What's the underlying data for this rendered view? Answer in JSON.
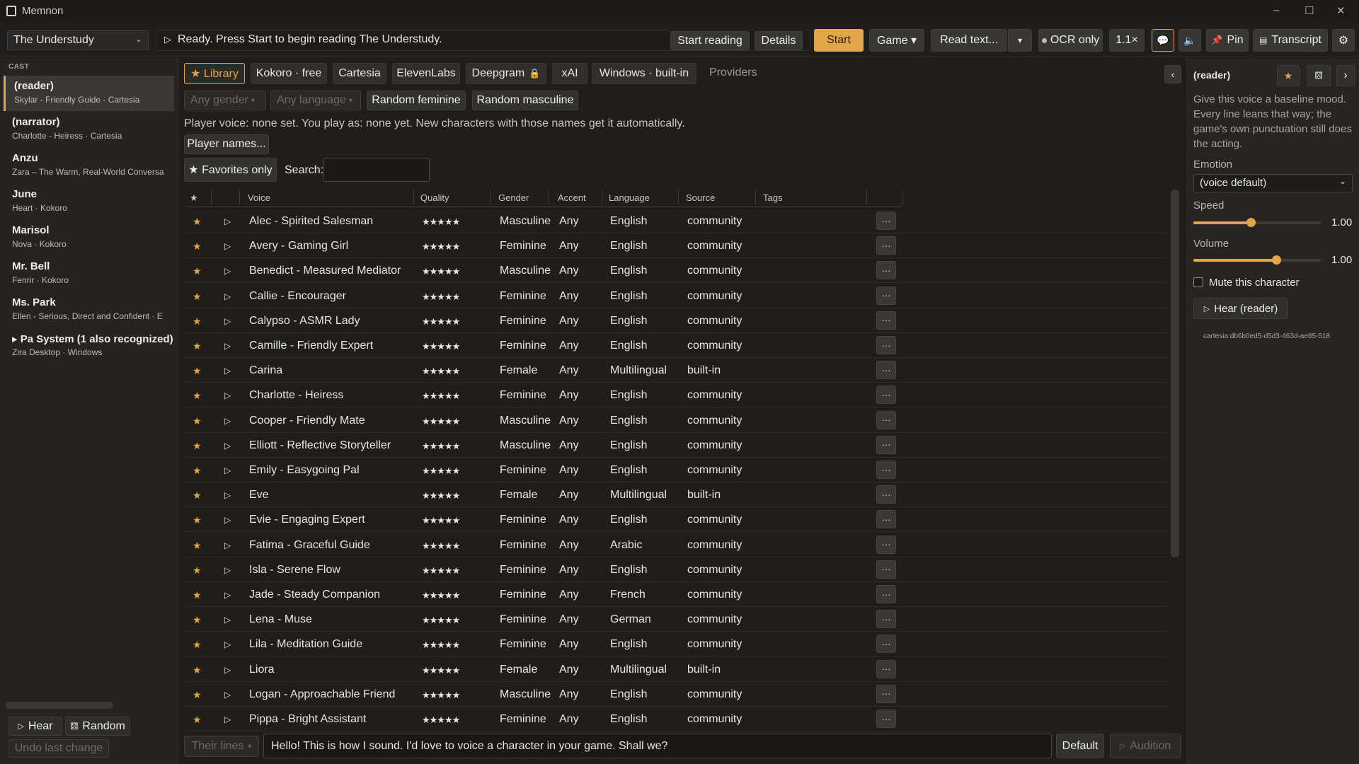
{
  "window": {
    "title": "Memnon",
    "minimize": "–",
    "maximize": "☐",
    "close": "✕"
  },
  "toolbar": {
    "game_selected": "The Understudy",
    "status_icon": "▷",
    "status": "Ready. Press Start to begin reading The Understudy.",
    "start_reading": "Start reading",
    "details": "Details",
    "start": "Start",
    "game_menu": "Game ▾",
    "read_text": "Read text...",
    "read_dropdown": "▾",
    "ocr_only": "OCR only",
    "speed": "1.1×",
    "pin": "Pin",
    "transcript": "Transcript"
  },
  "cast": {
    "header": "CAST",
    "items": [
      {
        "name": "(reader)",
        "sub": "Skylar - Friendly Guide · Cartesia",
        "selected": true
      },
      {
        "name": "(narrator)",
        "sub": "Charlotte - Heiress · Cartesia"
      },
      {
        "name": "Anzu",
        "sub": "Zara – The Warm, Real-World Conversa"
      },
      {
        "name": "June",
        "sub": "Heart · Kokoro"
      },
      {
        "name": "Marisol",
        "sub": "Nova · Kokoro"
      },
      {
        "name": "Mr. Bell",
        "sub": "Fenrir · Kokoro"
      },
      {
        "name": "Ms. Park",
        "sub": "Ellen - Serious, Direct and Confident · E"
      },
      {
        "name": "▸ Pa System (1 also recognized)",
        "sub": "Zira Desktop · Windows"
      }
    ],
    "hear": "Hear",
    "random": "Random",
    "undo": "Undo last change"
  },
  "tabs": [
    {
      "label": "★ Library",
      "active": true
    },
    {
      "label": "Kokoro · free"
    },
    {
      "label": "Cartesia"
    },
    {
      "label": "ElevenLabs"
    },
    {
      "label": "Deepgram"
    },
    {
      "label": "xAI"
    },
    {
      "label": "Windows · built-in"
    }
  ],
  "providers_label": "Providers",
  "filters": {
    "gender": "Any gender",
    "language": "Any language",
    "random_feminine": "Random feminine",
    "random_masculine": "Random masculine"
  },
  "player_info": "Player voice: none set. You play as: none yet. New characters with those names get it automatically.",
  "player_names": "Player names...",
  "favorites_only": "★ Favorites only",
  "search_label": "Search:",
  "search_value": "",
  "columns": [
    "★",
    "Voice",
    "Quality",
    "Gender",
    "Accent",
    "Language",
    "Source",
    "Tags"
  ],
  "voices": [
    {
      "voice": "Alec - Spirited Salesman",
      "quality": "★★★★★",
      "gender": "Masculine",
      "accent": "Any",
      "language": "English",
      "source": "community"
    },
    {
      "voice": "Avery - Gaming Girl",
      "quality": "★★★★★",
      "gender": "Feminine",
      "accent": "Any",
      "language": "English",
      "source": "community"
    },
    {
      "voice": "Benedict - Measured Mediator",
      "quality": "★★★★★",
      "gender": "Masculine",
      "accent": "Any",
      "language": "English",
      "source": "community"
    },
    {
      "voice": "Callie - Encourager",
      "quality": "★★★★★",
      "gender": "Feminine",
      "accent": "Any",
      "language": "English",
      "source": "community"
    },
    {
      "voice": "Calypso - ASMR Lady",
      "quality": "★★★★★",
      "gender": "Feminine",
      "accent": "Any",
      "language": "English",
      "source": "community"
    },
    {
      "voice": "Camille - Friendly Expert",
      "quality": "★★★★★",
      "gender": "Feminine",
      "accent": "Any",
      "language": "English",
      "source": "community"
    },
    {
      "voice": "Carina",
      "quality": "★★★★★",
      "gender": "Female",
      "accent": "Any",
      "language": "Multilingual",
      "source": "built-in"
    },
    {
      "voice": "Charlotte - Heiress",
      "quality": "★★★★★",
      "gender": "Feminine",
      "accent": "Any",
      "language": "English",
      "source": "community"
    },
    {
      "voice": "Cooper - Friendly Mate",
      "quality": "★★★★★",
      "gender": "Masculine",
      "accent": "Any",
      "language": "English",
      "source": "community"
    },
    {
      "voice": "Elliott - Reflective Storyteller",
      "quality": "★★★★★",
      "gender": "Masculine",
      "accent": "Any",
      "language": "English",
      "source": "community"
    },
    {
      "voice": "Emily - Easygoing Pal",
      "quality": "★★★★★",
      "gender": "Feminine",
      "accent": "Any",
      "language": "English",
      "source": "community"
    },
    {
      "voice": "Eve",
      "quality": "★★★★★",
      "gender": "Female",
      "accent": "Any",
      "language": "Multilingual",
      "source": "built-in"
    },
    {
      "voice": "Evie - Engaging Expert",
      "quality": "★★★★★",
      "gender": "Feminine",
      "accent": "Any",
      "language": "English",
      "source": "community"
    },
    {
      "voice": "Fatima - Graceful Guide",
      "quality": "★★★★★",
      "gender": "Feminine",
      "accent": "Any",
      "language": "Arabic",
      "source": "community"
    },
    {
      "voice": "Isla - Serene Flow",
      "quality": "★★★★★",
      "gender": "Feminine",
      "accent": "Any",
      "language": "English",
      "source": "community"
    },
    {
      "voice": "Jade - Steady Companion",
      "quality": "★★★★★",
      "gender": "Feminine",
      "accent": "Any",
      "language": "French",
      "source": "community"
    },
    {
      "voice": "Lena - Muse",
      "quality": "★★★★★",
      "gender": "Feminine",
      "accent": "Any",
      "language": "German",
      "source": "community"
    },
    {
      "voice": "Lila - Meditation Guide",
      "quality": "★★★★★",
      "gender": "Feminine",
      "accent": "Any",
      "language": "English",
      "source": "community"
    },
    {
      "voice": "Liora",
      "quality": "★★★★★",
      "gender": "Female",
      "accent": "Any",
      "language": "Multilingual",
      "source": "built-in"
    },
    {
      "voice": "Logan - Approachable Friend",
      "quality": "★★★★★",
      "gender": "Masculine",
      "accent": "Any",
      "language": "English",
      "source": "community"
    },
    {
      "voice": "Pippa - Bright Assistant",
      "quality": "★★★★★",
      "gender": "Feminine",
      "accent": "Any",
      "language": "English",
      "source": "community"
    }
  ],
  "bottom": {
    "their_lines": "Their lines",
    "sample_text": "Hello! This is how I sound. I'd love to voice a character in your game. Shall we?",
    "default": "Default",
    "audition": "Audition"
  },
  "panel": {
    "title": "(reader)",
    "description": "Give this voice a baseline mood. Every line leans that way; the game's own punctuation still does the acting.",
    "emotion_label": "Emotion",
    "emotion_value": "(voice default)",
    "speed_label": "Speed",
    "speed_value": "1.00",
    "speed_fraction": 0.45,
    "volume_label": "Volume",
    "volume_value": "1.00",
    "volume_fraction": 0.65,
    "mute_label": "Mute this character",
    "hear_label": "Hear (reader)",
    "voice_id": "cartesia:db6b0ed5-d5d3-463d-ae85-518"
  },
  "colors": {
    "accent": "#e2a54a",
    "background": "#1f1e1d",
    "sidebar": "#252423"
  }
}
